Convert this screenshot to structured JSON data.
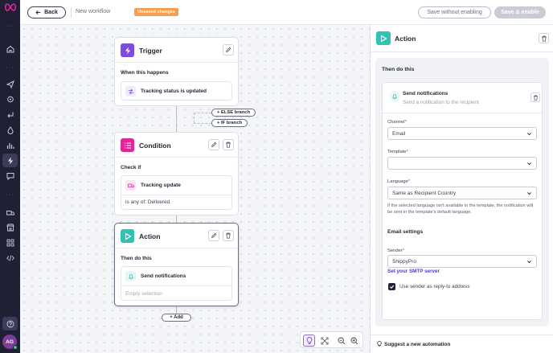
{
  "header": {
    "back_label": "Back",
    "workflow_title": "New workflow",
    "unsaved_badge": "Unsaved changes",
    "save_without_enabling": "Save without enabling",
    "save_and_enable": "Save & enable"
  },
  "sidebar": {
    "avatar_initials": "AG",
    "icons": [
      "home-icon",
      "send-icon",
      "location-icon",
      "return-icon",
      "drop-icon",
      "chart-icon",
      "automation-icon",
      "chat-icon",
      "truck-icon",
      "store-icon",
      "apps-icon",
      "code-icon",
      "help-icon"
    ]
  },
  "canvas": {
    "trigger": {
      "title": "Trigger",
      "section": "When this happens",
      "item": "Tracking status is updated"
    },
    "branches": {
      "else": "+ ELSE branch",
      "if": "+ IF branch"
    },
    "condition": {
      "title": "Condition",
      "section": "Check if",
      "item": "Tracking update",
      "detail": "is any of: Delivered"
    },
    "action": {
      "title": "Action",
      "section": "Then do this",
      "item": "Send notifications",
      "empty": "Empty selection"
    },
    "add_label": "+ Add"
  },
  "panel": {
    "title": "Action",
    "section_title": "Then do this",
    "card": {
      "title": "Send notifications",
      "description": "Send a notification to the recipient"
    },
    "fields": {
      "channel_label": "Channel",
      "channel_value": "Email",
      "template_label": "Template",
      "template_value": "",
      "language_label": "Language",
      "language_value": "Same as Recipient Country",
      "language_hint": "If the selected language isn't available in the template, the notification will be sent in the template's default language.",
      "email_settings": "Email settings",
      "sender_label": "Sender",
      "sender_value": "ShippyPro",
      "smtp_link": "Set your SMTP server",
      "reply_to_label": "Use sender as reply-to address",
      "reply_to_checked": true
    },
    "suggest": "Suggest a new automation"
  },
  "colors": {
    "trigger_accent": "#7d4cdb",
    "condition_accent": "#e0269a",
    "action_accent": "#30c3b3",
    "unsaved_badge": "#f59e4b",
    "link": "#4a3ad6"
  }
}
